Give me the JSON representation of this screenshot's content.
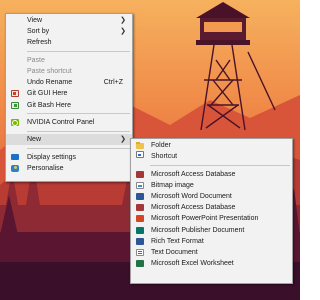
{
  "context_menu": {
    "items": [
      {
        "label": "View"
      },
      {
        "label": "Sort by"
      },
      {
        "label": "Refresh"
      },
      {
        "label": "Paste"
      },
      {
        "label": "Paste shortcut"
      },
      {
        "label": "Undo Rename",
        "shortcut": "Ctrl+Z"
      },
      {
        "label": "Git GUI Here",
        "icon": "git-gui-icon"
      },
      {
        "label": "Git Bash Here",
        "icon": "git-bash-icon"
      },
      {
        "label": "NVIDIA Control Panel",
        "icon": "nvidia-icon"
      },
      {
        "label": "New"
      },
      {
        "label": "Display settings",
        "icon": "display-settings-icon"
      },
      {
        "label": "Personalise",
        "icon": "personalise-icon"
      }
    ]
  },
  "new_submenu": {
    "items": [
      {
        "label": "Folder",
        "icon": "folder-icon"
      },
      {
        "label": "Shortcut",
        "icon": "shortcut-icon"
      },
      {
        "label": "Microsoft Access Database",
        "icon": "access-icon"
      },
      {
        "label": "Bitmap image",
        "icon": "bitmap-icon"
      },
      {
        "label": "Microsoft Word Document",
        "icon": "word-icon"
      },
      {
        "label": "Microsoft Access Database",
        "icon": "access-icon"
      },
      {
        "label": "Microsoft PowerPoint Presentation",
        "icon": "powerpoint-icon"
      },
      {
        "label": "Microsoft Publisher Document",
        "icon": "publisher-icon"
      },
      {
        "label": "Rich Text Format",
        "icon": "rtf-icon"
      },
      {
        "label": "Text Document",
        "icon": "text-document-icon"
      },
      {
        "label": "Microsoft Excel Worksheet",
        "icon": "excel-icon"
      }
    ]
  },
  "colors": {
    "menu_background": "#f2f2f2",
    "hover_background": "#dcdcdc",
    "disabled_text": "#8a8a8a",
    "sky_top": "#f4a055",
    "forest_dark": "#3a0f2a"
  }
}
